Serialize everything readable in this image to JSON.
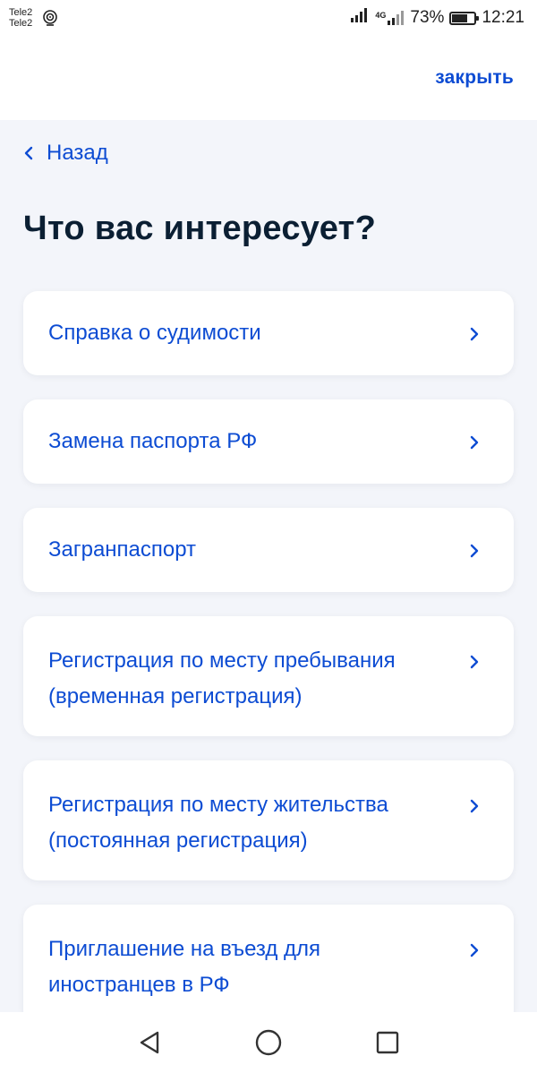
{
  "status_bar": {
    "carrier_1": "Tele2",
    "carrier_2": "Tele2",
    "network": "4G",
    "battery_text": "73%",
    "battery_level": 0.73,
    "time": "12:21"
  },
  "header": {
    "close_label": "закрыть"
  },
  "nav": {
    "back_label": "Назад",
    "back_icon": "chevron-left-icon"
  },
  "page": {
    "title": "Что вас интересует?"
  },
  "options": [
    {
      "line1": "Справка о судимости",
      "line2": ""
    },
    {
      "line1": "Замена паспорта РФ",
      "line2": ""
    },
    {
      "line1": "Загранпаспорт",
      "line2": ""
    },
    {
      "line1": "Регистрация по месту пребывания",
      "line2": "(временная регистрация)"
    },
    {
      "line1": "Регистрация по месту жительства",
      "line2": "(постоянная регистрация)"
    },
    {
      "line1": "Приглашение на въезд для",
      "line2": "иностранцев в РФ"
    }
  ],
  "colors": {
    "accent": "#0D4CD3",
    "text": "#0B1F33",
    "background": "#F3F5FA",
    "card": "#FFFFFF"
  },
  "system_nav": {
    "back_icon": "triangle-back-icon",
    "home_icon": "circle-home-icon",
    "recents_icon": "square-recents-icon"
  }
}
